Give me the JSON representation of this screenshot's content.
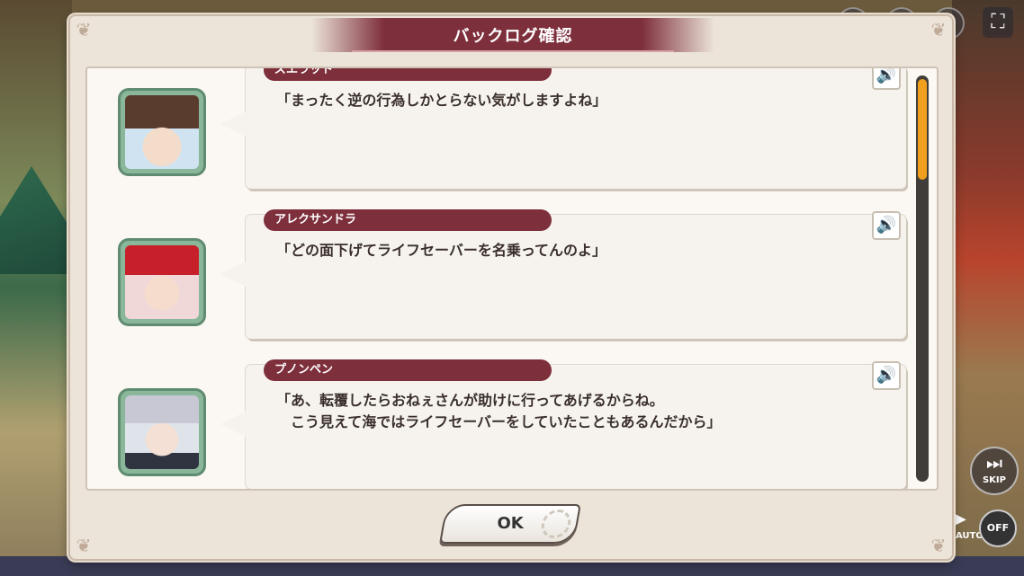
{
  "dialog": {
    "title": "バックログ確認",
    "ok_label": "OK"
  },
  "log_entries": [
    {
      "speaker": "ズエラット",
      "lines": [
        "「まったく逆の行為しかとらない気がしますよね」"
      ],
      "avatar_hair": "#5a3c2e",
      "avatar_bg": "#cfe4f0"
    },
    {
      "speaker": "アレクサンドラ",
      "lines": [
        "「どの面下げてライフセーバーを名乗ってんのよ」"
      ],
      "avatar_hair": "#c8202a",
      "avatar_bg": "#f0d8d8"
    },
    {
      "speaker": "プノンペン",
      "lines": [
        "「あ、転覆したらおねぇさんが助けに行ってあげるからね。",
        "　こう見えて海ではライフセーバーをしていたこともあるんだから」"
      ],
      "avatar_hair": "#c8c8d4",
      "avatar_bg": "#dfe4ea"
    }
  ],
  "controls": {
    "skip_label": "SKIP",
    "auto_label": "AUTO",
    "auto_state": "OFF"
  },
  "icons": {
    "voice": "speaker-icon",
    "fullscreen": "fullscreen-icon",
    "skip": "skip-icon",
    "auto": "play-icon"
  },
  "scroll": {
    "position_fraction": 0.0
  },
  "colors": {
    "accent": "#7e2f3c",
    "scroll_thumb": "#f0a01c",
    "avatar_frame": "#8ab69a"
  }
}
